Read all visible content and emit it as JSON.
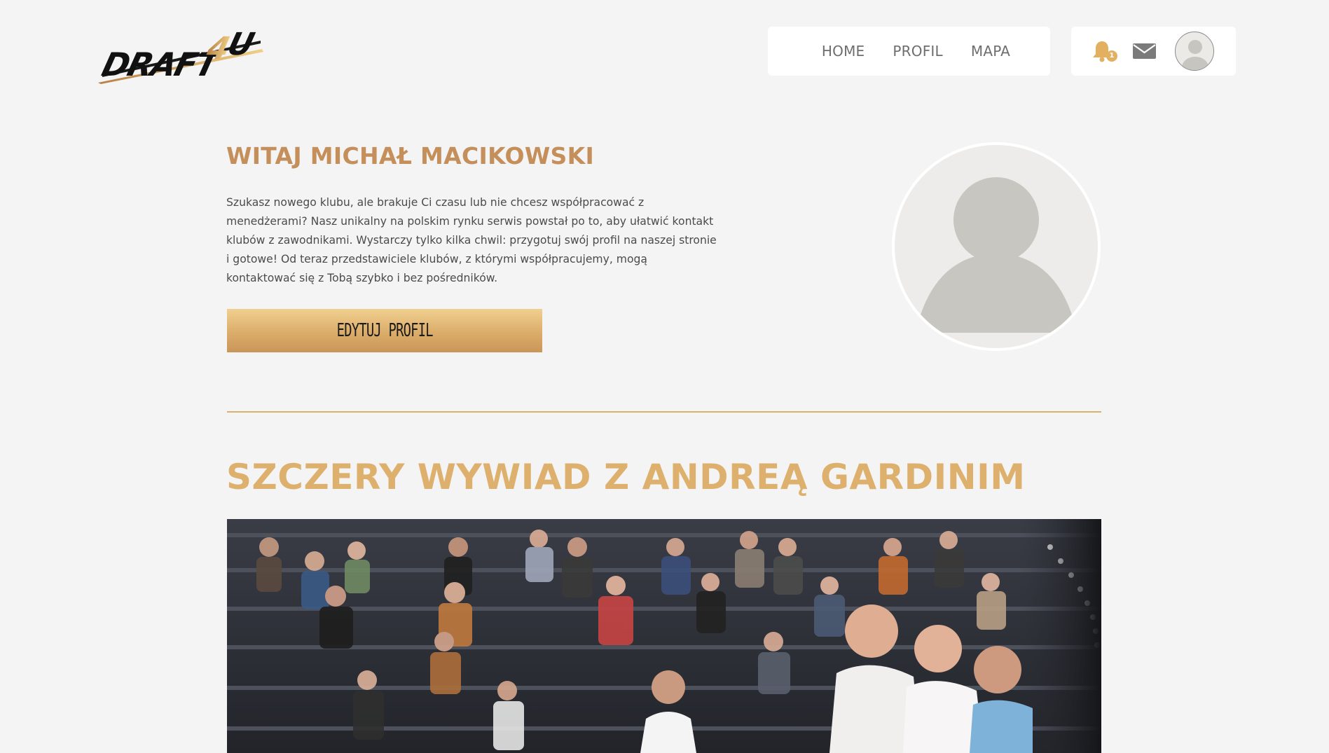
{
  "header": {
    "logo_text": "DRAFT4U",
    "nav": [
      {
        "label": "HOME"
      },
      {
        "label": "PROFIL"
      },
      {
        "label": "MAPA"
      }
    ],
    "notifications": {
      "count": "1",
      "icon": "bell-icon"
    },
    "messages": {
      "icon": "mail-icon"
    },
    "user_avatar": {
      "icon": "user-avatar-placeholder"
    }
  },
  "welcome": {
    "title": "WITAJ MICHAŁ MACIKOWSKI",
    "text": "Szukasz nowego klubu, ale brakuje Ci czasu lub nie chcesz współpracować z menedżerami? Nasz unikalny na polskim rynku serwis powstał po to, aby ułatwić kontakt klubów z zawodnikami. Wystarczy tylko kilka chwil: przygotuj swój profil na naszej stronie i gotowe! Od teraz przedstawiciele klubów, z którymi współpracujemy, mogą kontaktować się z Tobą szybko i bez pośredników.",
    "edit_button": "EDYTUJ PROFIL"
  },
  "article": {
    "title": "SZCZERY WYWIAD Z ANDREĄ GARDINIM"
  },
  "colors": {
    "accent": "#c48f5a",
    "accent_light": "#ddb06d",
    "background": "#f4f4f4"
  }
}
